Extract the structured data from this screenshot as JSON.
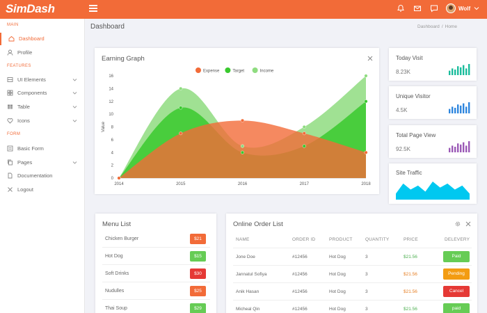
{
  "app": {
    "logo_text": "SimDash",
    "username": "Wolf"
  },
  "sidebar": {
    "sections": {
      "main": "MAIN",
      "features": "FEATURES",
      "form": "FORM"
    },
    "items": [
      {
        "label": "Dashboard",
        "icon": "home-icon",
        "active": true
      },
      {
        "label": "Profile",
        "icon": "user-icon"
      },
      {
        "label": "UI Elements",
        "icon": "layers-icon",
        "has_children": true
      },
      {
        "label": "Components",
        "icon": "grid-icon",
        "has_children": true
      },
      {
        "label": "Table",
        "icon": "table-icon",
        "has_children": true
      },
      {
        "label": "Icons",
        "icon": "heart-icon",
        "has_children": true
      },
      {
        "label": "Basic Form",
        "icon": "form-icon"
      },
      {
        "label": "Pages",
        "icon": "copy-icon",
        "has_children": true
      },
      {
        "label": "Documentation",
        "icon": "document-icon"
      },
      {
        "label": "Logout",
        "icon": "close-icon"
      }
    ]
  },
  "page": {
    "title": "Dashboard",
    "breadcrumb": [
      "Dashboard",
      "Home"
    ]
  },
  "earning": {
    "title": "Earning Graph",
    "chart_data": {
      "type": "area",
      "title": "Earning Graph",
      "ylabel": "Value",
      "xlabel": "",
      "x": [
        "2014",
        "2015",
        "2016",
        "2017",
        "2018"
      ],
      "ylim": [
        0,
        16
      ],
      "yticks": [
        0,
        2,
        4,
        6,
        8,
        10,
        12,
        14,
        16
      ],
      "legend_position": "top-center",
      "series": [
        {
          "name": "Expense",
          "color": "#f26b38",
          "values": [
            0,
            7,
            9,
            7,
            4
          ]
        },
        {
          "name": "Target",
          "color": "#39c92e",
          "values": [
            0,
            11,
            4,
            5,
            12
          ]
        },
        {
          "name": "Income",
          "color": "#8fdc80",
          "values": [
            0,
            14,
            5,
            8,
            16
          ]
        }
      ],
      "grid": false
    }
  },
  "stats": [
    {
      "title": "Today Visit",
      "value": "8.23K",
      "color": "#1abc9c",
      "bars": [
        4,
        6,
        5,
        8,
        7,
        9,
        6,
        10
      ]
    },
    {
      "title": "Unique Visitor",
      "value": "4.5K",
      "color": "#2e86de",
      "bars": [
        4,
        6,
        5,
        8,
        7,
        9,
        6,
        10
      ]
    },
    {
      "title": "Total Page View",
      "value": "92.5K",
      "color": "#9b59b6",
      "bars": [
        4,
        6,
        5,
        8,
        7,
        9,
        6,
        10
      ]
    }
  ],
  "traffic": {
    "title": "Site Traffic",
    "color": "#00c8f0",
    "values": [
      3,
      8,
      5,
      7,
      4,
      9,
      6,
      8,
      5,
      7,
      3
    ]
  },
  "menu": {
    "title": "Menu List",
    "items": [
      {
        "name": "Chicken Burger",
        "price": "$21",
        "color": "#f26b38"
      },
      {
        "name": "Hot Dog",
        "price": "$15",
        "color": "#66cc55"
      },
      {
        "name": "Soft Drinks",
        "price": "$30",
        "color": "#e53935"
      },
      {
        "name": "Nudulles",
        "price": "$25",
        "color": "#f26b38"
      },
      {
        "name": "Thai Soup",
        "price": "$29",
        "color": "#66cc55"
      }
    ]
  },
  "orders": {
    "title": "Online Order List",
    "columns": [
      "NAME",
      "ORDER ID",
      "PRODUCT",
      "QUANTITY",
      "PRICE",
      "DELEVERY"
    ],
    "rows": [
      {
        "name": "Jone Doe",
        "order_id": "#12456",
        "product": "Hot Dog",
        "quantity": "3",
        "price": "$21.56",
        "price_color": "green",
        "status": "Paid",
        "status_color": "#66cc55"
      },
      {
        "name": "Jannatul Sofiya",
        "order_id": "#12456",
        "product": "Hot Dog",
        "quantity": "3",
        "price": "$21.56",
        "price_color": "orange",
        "status": "Pending",
        "status_color": "#f39c12"
      },
      {
        "name": "Anik Hasan",
        "order_id": "#12456",
        "product": "Hot Dog",
        "quantity": "3",
        "price": "$21.56",
        "price_color": "orange",
        "status": "Cancel",
        "status_color": "#e53935"
      },
      {
        "name": "Micheal Qin",
        "order_id": "#12456",
        "product": "Hot Dog",
        "quantity": "3",
        "price": "$21.56",
        "price_color": "green",
        "status": "paid",
        "status_color": "#66cc55"
      }
    ]
  }
}
